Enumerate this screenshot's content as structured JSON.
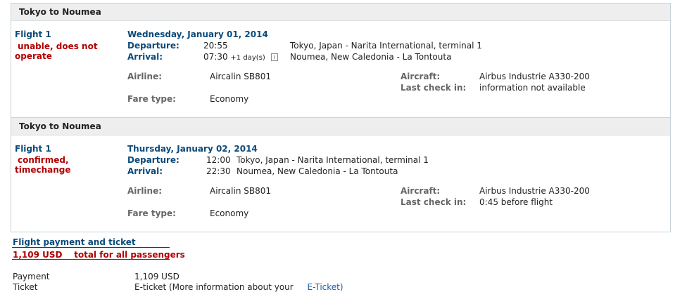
{
  "segments": [
    {
      "header": "Tokyo to Noumea",
      "flight": "Flight 1",
      "status": [
        "unable, does not",
        "operate"
      ],
      "date": "Wednesday, January 01, 2014",
      "departure_label": "Departure:",
      "departure_time": "20:55",
      "departure_place": "Tokyo, Japan - Narita International, terminal 1",
      "arrival_label": "Arrival:",
      "arrival_time": "07:30",
      "arrival_extra": "+1 day(s)",
      "arrival_place": "Noumea, New Caledonia - La Tontouta",
      "airline_label": "Airline:",
      "airline": "Aircalin SB801",
      "fare_label": "Fare type:",
      "fare": "Economy",
      "aircraft_label": "Aircraft:",
      "aircraft": "Airbus Industrie A330-200",
      "checkin_label": "Last check in:",
      "checkin": "information not available"
    },
    {
      "header": "Tokyo to Noumea",
      "flight": "Flight 1",
      "status": [
        "confirmed,",
        "timechange"
      ],
      "date": "Thursday, January 02, 2014",
      "departure_label": "Departure:",
      "departure_time": "12:00",
      "departure_place": "Tokyo, Japan - Narita International, terminal 1",
      "arrival_label": "Arrival:",
      "arrival_time": "22:30",
      "arrival_place": "Noumea, New Caledonia - La Tontouta",
      "airline_label": "Airline:",
      "airline": "Aircalin SB801",
      "fare_label": "Fare type:",
      "fare": "Economy",
      "aircraft_label": "Aircraft:",
      "aircraft": "Airbus Industrie A330-200",
      "checkin_label": "Last check in:",
      "checkin": "0:45 before flight"
    }
  ],
  "payment": {
    "title": "Flight payment and ticket",
    "total_amount": "1,109 USD",
    "total_note": "total for all passengers",
    "payment_label": "Payment",
    "payment_value": "1,109 USD",
    "ticket_label": "Ticket",
    "ticket_value": "E-ticket (More information about your",
    "ticket_link": "E-Ticket)"
  },
  "colors": {
    "accent": "#0b4a7a",
    "alert": "#b00000",
    "border": "#c7d3d8",
    "header_bg": "#eeeeee"
  }
}
